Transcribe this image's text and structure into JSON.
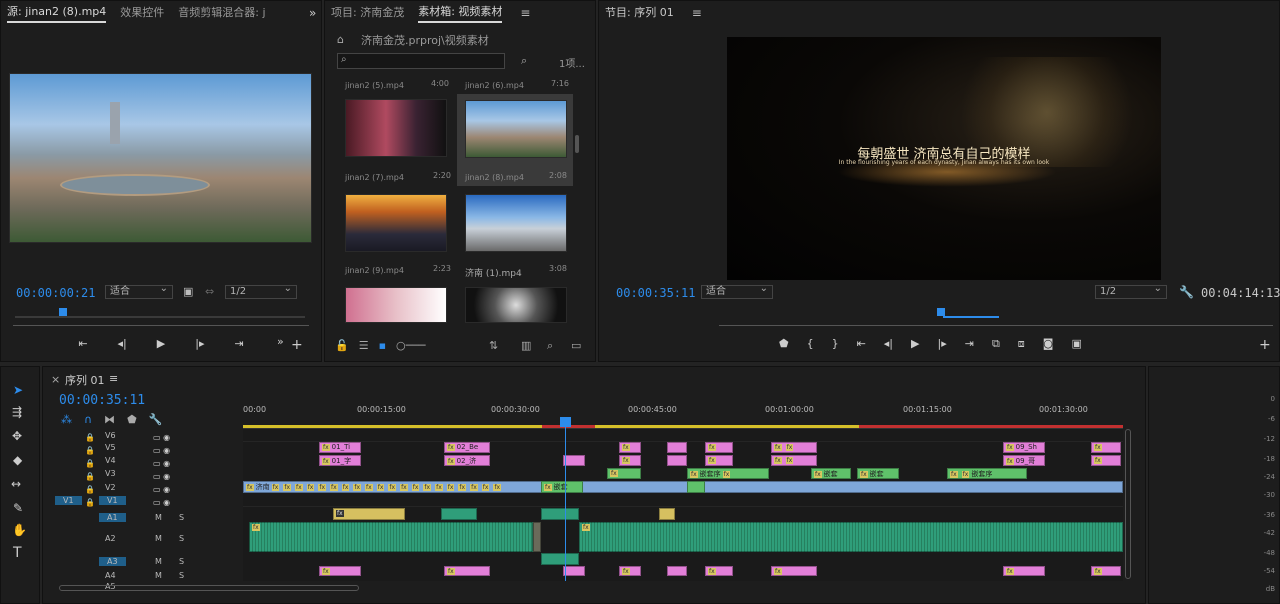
{
  "source_panel": {
    "tabs": [
      "源: jinan2 (8).mp4",
      "效果控件",
      "音频剪辑混合器: j"
    ],
    "more": "»",
    "timecode": "00:00:00:21",
    "fit": "适合",
    "quality": "1/2"
  },
  "project_panel": {
    "tabs": [
      "项目: 济南金茂",
      "素材箱: 视频素材"
    ],
    "path": "济南金茂.prproj\\视频素材",
    "search_placeholder": "",
    "count": "1项...",
    "items": [
      {
        "name": "jinan2 (5).mp4",
        "duration": "4:00"
      },
      {
        "name": "jinan2 (6).mp4",
        "duration": "7:16"
      },
      {
        "name": "jinan2 (7).mp4",
        "duration": "2:20"
      },
      {
        "name": "jinan2 (8).mp4",
        "duration": "2:08"
      },
      {
        "name": "jinan2 (9).mp4",
        "duration": "2:23"
      },
      {
        "name": "济南 (1).mp4",
        "duration": "3:08"
      }
    ]
  },
  "program_panel": {
    "title": "节目: 序列 01",
    "timecode": "00:00:35:11",
    "fit": "适合",
    "quality": "1/2",
    "duration": "00:04:14:13",
    "video_title": "每朝盛世 济南总有自己的模样",
    "video_subtitle": "In the flourishing years of each dynasty, Jinan always has its own look"
  },
  "timeline": {
    "tab": "序列 01",
    "close": "×",
    "timecode": "00:00:35:11",
    "ruler": [
      "00:00",
      "00:00:15:00",
      "00:00:30:00",
      "00:00:45:00",
      "00:01:00:00",
      "00:01:15:00",
      "00:01:30:00"
    ],
    "video_tracks": [
      "V6",
      "V5",
      "V4",
      "V3",
      "V2",
      "V1"
    ],
    "audio_tracks": [
      "A1",
      "A2",
      "A3",
      "A4",
      "A5"
    ],
    "source_patch_v": "V1",
    "m_label": "M",
    "s_label": "S",
    "clip_labels": {
      "v5a": "01_Ti",
      "v5b": "02_Be",
      "v5c": "09_Sh",
      "v4a": "01_字",
      "v4b": "02_济",
      "v4c": "09_哥",
      "v3": "嵌套序",
      "v2": "济南",
      "v1": "嵌套"
    },
    "db_scale": [
      "0",
      "-6",
      "-12",
      "-18",
      "-24",
      "-30",
      "-36",
      "-42",
      "-48",
      "-54",
      "dB"
    ]
  },
  "colors": {
    "accent": "#2d8ceb",
    "pink_clip": "#e27fd8",
    "green_clip": "#5fc16a",
    "blue_clip": "#7fa7d9",
    "audio_green": "#2f9e7a"
  }
}
